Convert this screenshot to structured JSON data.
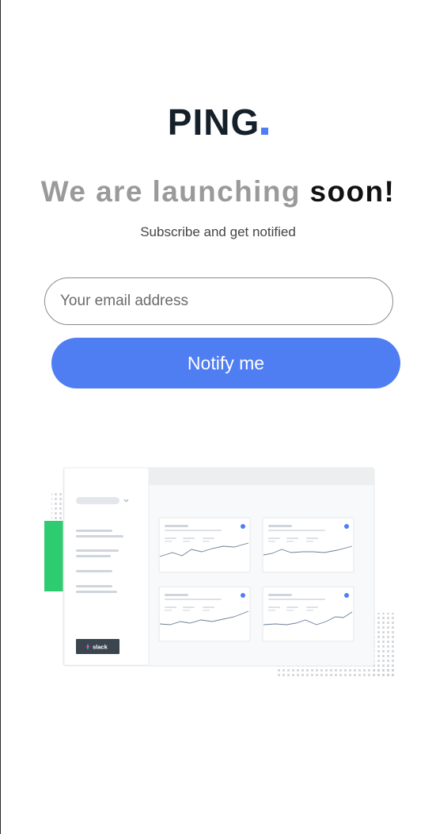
{
  "brand": {
    "name": "PING"
  },
  "headline": {
    "light": "We are launching",
    "dark": "soon!"
  },
  "subtitle": "Subscribe and get notified",
  "form": {
    "email_placeholder": "Your email address",
    "submit_label": "Notify me"
  },
  "illustration": {
    "integration_label": "slack"
  },
  "colors": {
    "accent": "#4f7ef3",
    "brand_dark": "#15202b",
    "headline_light": "#9a9a9a",
    "illustration_green": "#2ecc71"
  }
}
